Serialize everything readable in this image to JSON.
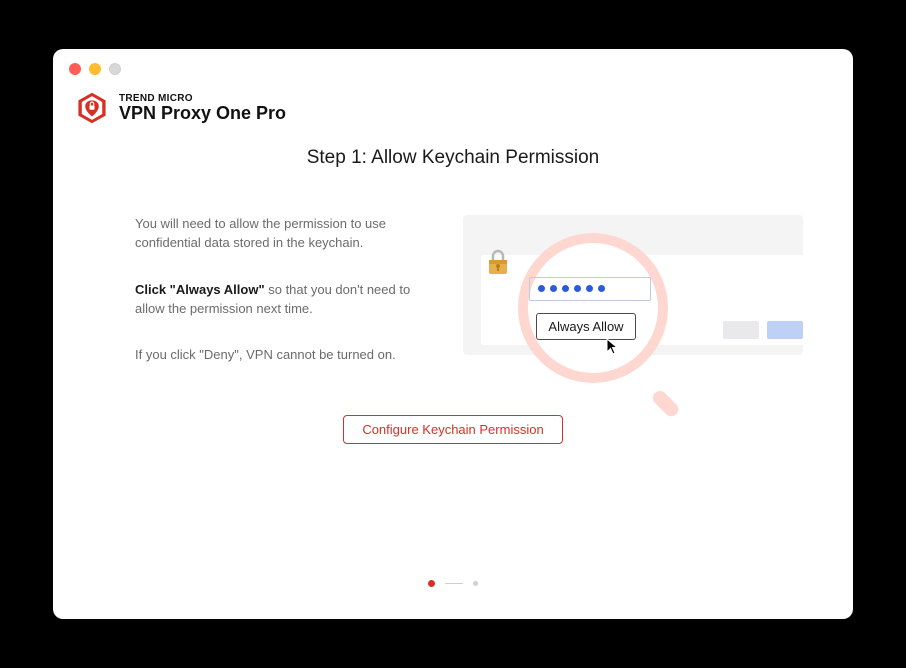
{
  "brand": {
    "company": "TREND MICRO",
    "product": "VPN Proxy One Pro"
  },
  "step": {
    "title": "Step 1: Allow Keychain Permission"
  },
  "instructions": {
    "para1": "You will need to allow the permission to use confidential data stored in the keychain.",
    "para2_bold": "Click \"Always Allow\"",
    "para2_rest": " so that you don't need to allow the permission next time.",
    "para3": "If you click \"Deny\", VPN cannot be turned on."
  },
  "illustration": {
    "allow_button_label": "Always Allow"
  },
  "cta": {
    "configure_label": "Configure Keychain Permission"
  },
  "pager": {
    "current": 1,
    "total": 2
  },
  "colors": {
    "accent": "#d93025"
  }
}
